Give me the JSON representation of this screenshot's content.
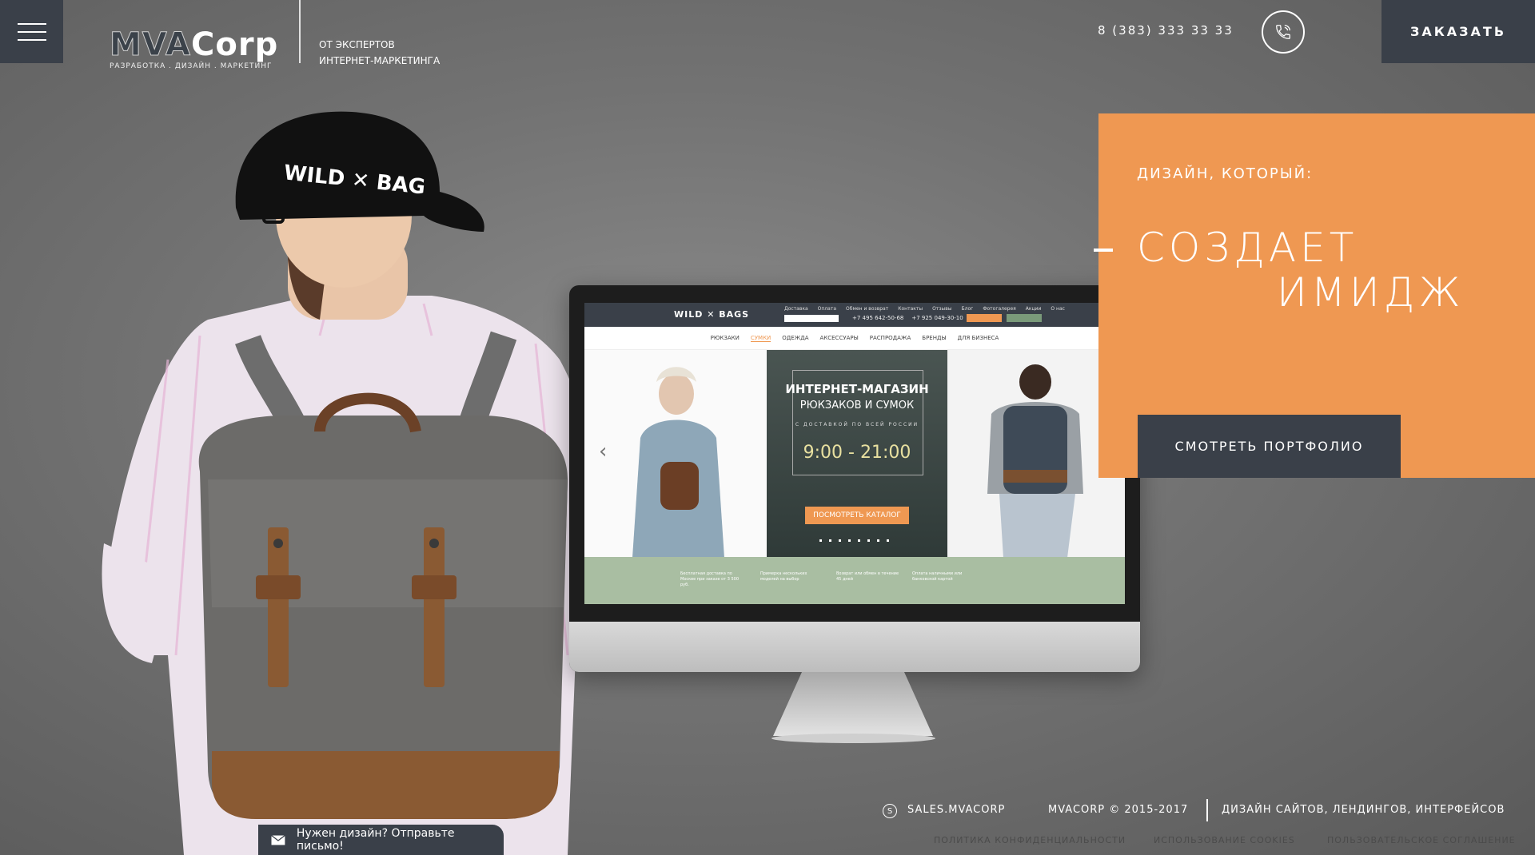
{
  "header": {
    "logo_left": "MVA",
    "logo_right": "Corp",
    "logo_sub": "РАЗРАБОТКА . ДИЗАЙН . МАРКЕТИНГ",
    "tagline_line1": "ОТ ЭКСПЕРТОВ",
    "tagline_line2": "ИНТЕРНЕТ-МАРКЕТИНГА",
    "phone": "8 (383) 333 33 33",
    "order_label": "ЗАКАЗАТЬ",
    "menu_icon": "hamburger-icon",
    "call_icon": "phone-icon"
  },
  "hero": {
    "kicker": "ДИЗАЙН, КОТОРЫЙ:",
    "title_line1": "СОЗДАЕТ",
    "title_line2": "ИМИДЖ",
    "portfolio_label": "СМОТРЕТЬ ПОРТФОЛИО"
  },
  "screen": {
    "logo": "WILD ✕ BAGS",
    "menu": [
      "Доставка",
      "Оплата",
      "Обмен и возврат",
      "Контакты",
      "Отзывы",
      "Блог",
      "Фотогалерея",
      "Акции",
      "О нас"
    ],
    "phones": [
      "+7 495 642-50-68",
      "+7 925 049-30-10"
    ],
    "nav": [
      "РЮКЗАКИ",
      "СУМКИ",
      "ОДЕЖДА",
      "АКСЕССУАРЫ",
      "РАСПРОДАЖА",
      "БРЕНДЫ",
      "ДЛЯ БИЗНЕСА"
    ],
    "nav_active": "СУМКИ",
    "banner_title": "ИНТЕРНЕТ-МАГАЗИН",
    "banner_subtitle": "РЮКЗАКОВ И СУМОК",
    "banner_note": "С ДОСТАВКОЙ ПО ВСЕЙ РОССИИ",
    "banner_time": "9:00 - 21:00",
    "banner_cta": "ПОСМОТРЕТЬ КАТАЛОГ",
    "features": [
      "Бесплатная доставка по Москве при заказе от 3 500 руб.",
      "Примерка нескольких моделей на выбор",
      "Возврат или обмен в течение 45 дней",
      "Оплата наличными или банковской картой"
    ]
  },
  "footer": {
    "skype_icon": "skype-icon",
    "skype": "SALES.MVACORP",
    "copyright": "MVACORP © 2015-2017",
    "services": "ДИЗАЙН САЙТОВ, ЛЕНДИНГОВ, ИНТЕРФЕЙСОВ",
    "privacy": "ПОЛИТИКА КОНФИДЕНЦИАЛЬНОСТИ",
    "cookies": "ИСПОЛЬЗОВАНИЕ COOKIES",
    "agreement": "ПОЛЬЗОВАТЕЛЬСКОЕ СОГЛАШЕНИЕ",
    "mail_icon": "envelope-icon",
    "mail_cta": "Нужен дизайн? Отправьте письмо!"
  },
  "colors": {
    "accent": "#ef9852",
    "dark": "#3a4049",
    "bg": "#727272"
  }
}
